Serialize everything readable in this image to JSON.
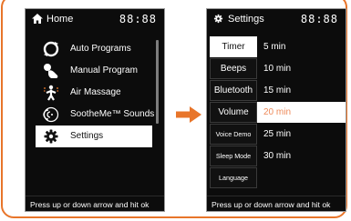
{
  "colors": {
    "accent": "#e8752a",
    "highlight_text": "#ee8a5a",
    "screen_bg": "#0c0c0c"
  },
  "home_screen": {
    "title": "Home",
    "title_icon": "home-icon",
    "clock": "88:88",
    "menu": [
      {
        "label": "Auto Programs",
        "icon": "auto-programs-icon",
        "selected": false
      },
      {
        "label": "Manual Program",
        "icon": "manual-program-icon",
        "selected": false
      },
      {
        "label": "Air Massage",
        "icon": "air-massage-icon",
        "selected": false
      },
      {
        "label": "SootheMe™ Sounds",
        "icon": "soothe-sounds-icon",
        "selected": false
      },
      {
        "label": "Settings",
        "icon": "settings-gear-icon",
        "selected": true
      }
    ],
    "footer": "Press up or down arrow and hit ok"
  },
  "settings_screen": {
    "title": "Settings",
    "title_icon": "gear-icon",
    "clock": "88:88",
    "tabs": [
      {
        "label": "Timer",
        "active": true
      },
      {
        "label": "Beeps",
        "active": false
      },
      {
        "label": "Bluetooth",
        "active": false
      },
      {
        "label": "Volume",
        "active": false
      },
      {
        "label": "Voice Demo",
        "active": false
      },
      {
        "label": "Sleep Mode",
        "active": false
      },
      {
        "label": "Language",
        "active": false
      }
    ],
    "values": [
      {
        "label": "5 min",
        "active": false
      },
      {
        "label": "10 min",
        "active": false
      },
      {
        "label": "15 min",
        "active": false
      },
      {
        "label": "20 min",
        "active": true
      },
      {
        "label": "25 min",
        "active": false
      },
      {
        "label": "30 min",
        "active": false
      }
    ],
    "footer": "Press up or down arrow and hit ok"
  },
  "transition_arrow_icon": "right-arrow-icon"
}
